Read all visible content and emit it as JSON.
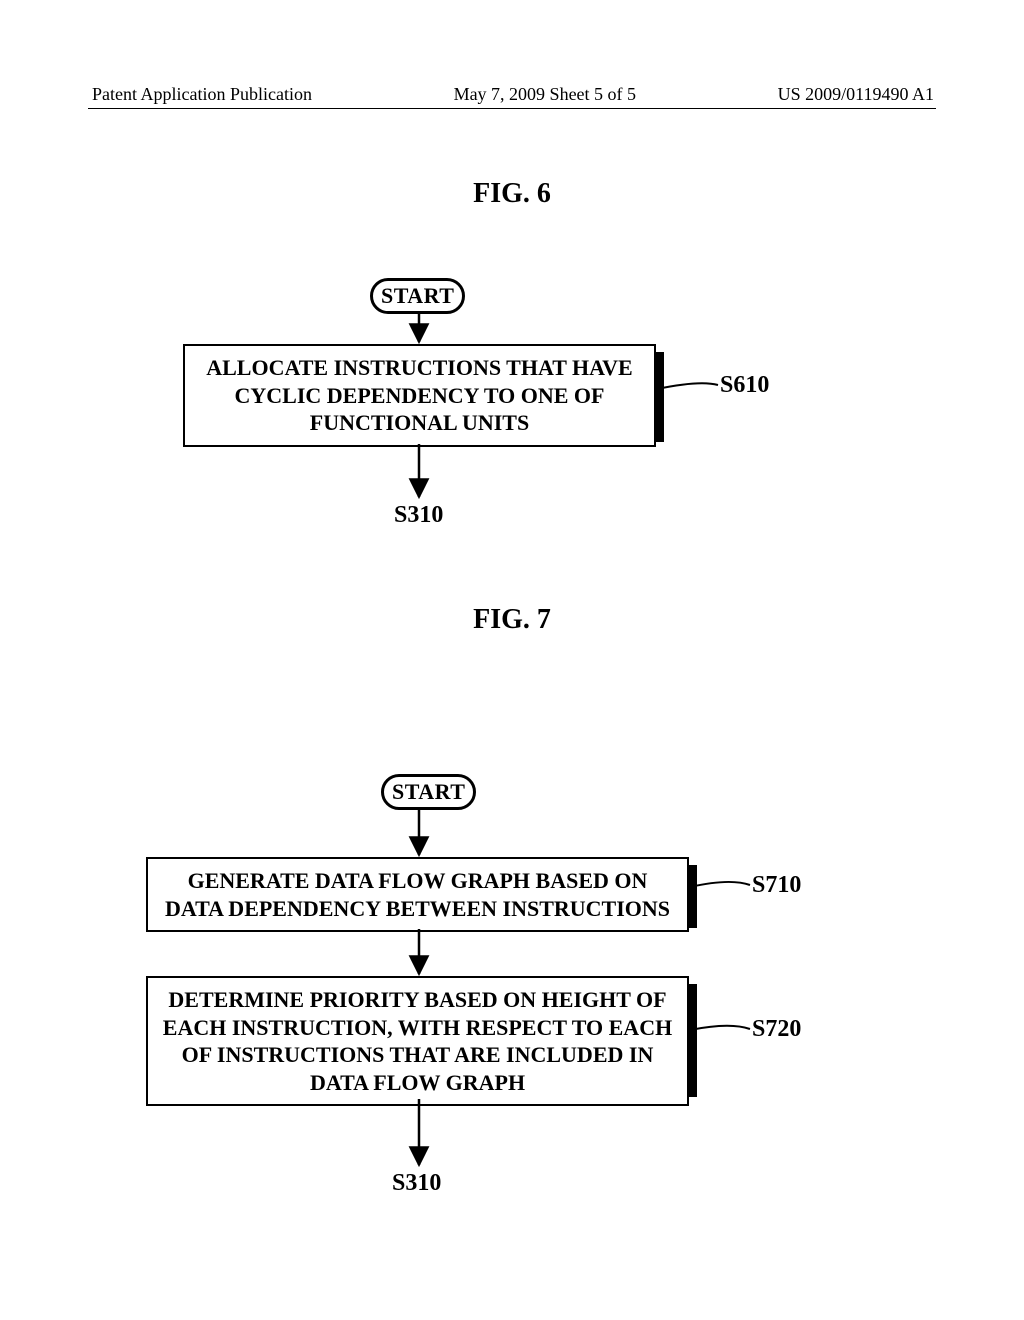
{
  "header": {
    "left": "Patent Application Publication",
    "center": "May 7, 2009  Sheet 5 of 5",
    "right": "US 2009/0119490 A1"
  },
  "figures": {
    "fig6": {
      "title": "FIG. 6",
      "start": "START",
      "steps": {
        "s610": {
          "text": "ALLOCATE INSTRUCTIONS THAT HAVE CYCLIC DEPENDENCY TO ONE OF FUNCTIONAL UNITS",
          "ref": "S610"
        }
      },
      "exit_ref": "S310"
    },
    "fig7": {
      "title": "FIG. 7",
      "start": "START",
      "steps": {
        "s710": {
          "text": "GENERATE DATA FLOW GRAPH BASED ON DATA DEPENDENCY BETWEEN INSTRUCTIONS",
          "ref": "S710"
        },
        "s720": {
          "text": "DETERMINE PRIORITY BASED ON HEIGHT OF EACH INSTRUCTION, WITH RESPECT TO EACH OF INSTRUCTIONS THAT ARE INCLUDED IN DATA FLOW GRAPH",
          "ref": "S720"
        }
      },
      "exit_ref": "S310"
    }
  },
  "chart_data": [
    {
      "type": "flowchart",
      "title": "FIG. 6",
      "nodes": [
        {
          "id": "start",
          "kind": "terminator",
          "label": "START"
        },
        {
          "id": "S610",
          "kind": "process",
          "label": "ALLOCATE INSTRUCTIONS THAT HAVE CYCLIC DEPENDENCY TO ONE OF FUNCTIONAL UNITS"
        },
        {
          "id": "S310",
          "kind": "offpage",
          "label": "S310"
        }
      ],
      "edges": [
        {
          "from": "start",
          "to": "S610"
        },
        {
          "from": "S610",
          "to": "S310"
        }
      ]
    },
    {
      "type": "flowchart",
      "title": "FIG. 7",
      "nodes": [
        {
          "id": "start",
          "kind": "terminator",
          "label": "START"
        },
        {
          "id": "S710",
          "kind": "process",
          "label": "GENERATE DATA FLOW GRAPH BASED ON DATA DEPENDENCY BETWEEN INSTRUCTIONS"
        },
        {
          "id": "S720",
          "kind": "process",
          "label": "DETERMINE PRIORITY BASED ON HEIGHT OF EACH INSTRUCTION, WITH RESPECT TO EACH OF INSTRUCTIONS THAT ARE INCLUDED IN DATA FLOW GRAPH"
        },
        {
          "id": "S310",
          "kind": "offpage",
          "label": "S310"
        }
      ],
      "edges": [
        {
          "from": "start",
          "to": "S710"
        },
        {
          "from": "S710",
          "to": "S720"
        },
        {
          "from": "S720",
          "to": "S310"
        }
      ]
    }
  ]
}
